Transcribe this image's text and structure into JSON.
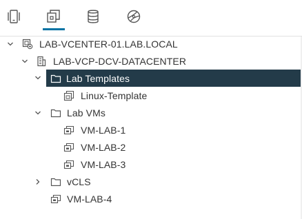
{
  "tabs": [
    {
      "name": "hosts-clusters-icon",
      "active": false
    },
    {
      "name": "vms-templates-icon",
      "active": true
    },
    {
      "name": "storage-icon",
      "active": false
    },
    {
      "name": "networking-icon",
      "active": false
    }
  ],
  "tree": {
    "vcenter": {
      "label": "LAB-VCENTER-01.LAB.LOCAL",
      "expanded": true
    },
    "datacenter": {
      "label": "LAB-VCP-DCV-DATACENTER",
      "expanded": true
    },
    "folder_templates": {
      "label": "Lab Templates",
      "expanded": true,
      "selected": true
    },
    "template_linux": {
      "label": "Linux-Template"
    },
    "folder_vms": {
      "label": "Lab VMs",
      "expanded": true
    },
    "vm1": {
      "label": "VM-LAB-1"
    },
    "vm2": {
      "label": "VM-LAB-2"
    },
    "vm3": {
      "label": "VM-LAB-3"
    },
    "folder_vcls": {
      "label": "vCLS",
      "expanded": false
    },
    "vm4": {
      "label": "VM-LAB-4"
    }
  },
  "colors": {
    "accent": "#0072a3",
    "selected_bg": "#233b49",
    "text": "#333333",
    "icon": "#555555"
  }
}
